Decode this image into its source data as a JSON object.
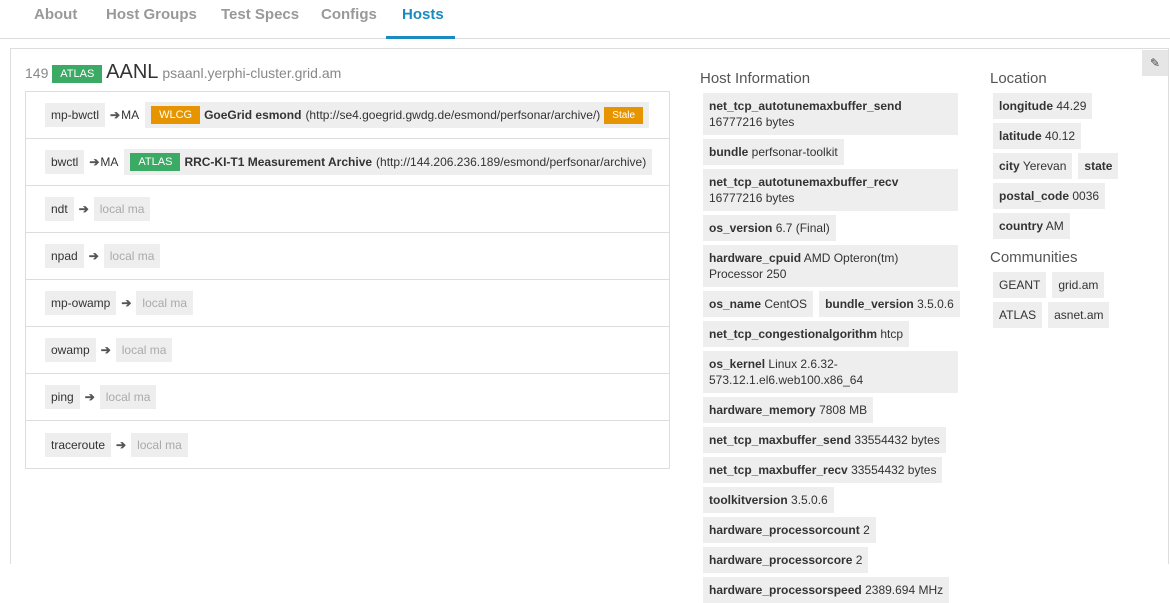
{
  "nav": {
    "tabs": [
      {
        "label": "About"
      },
      {
        "label": "Host Groups"
      },
      {
        "label": "Test Specs"
      },
      {
        "label": "Configs"
      },
      {
        "label": "Hosts",
        "active": true
      }
    ]
  },
  "host": {
    "id": "149",
    "community": "ATLAS",
    "sitename": "AANL",
    "hostname": "psaanl.yerphi-cluster.grid.am"
  },
  "tests": [
    {
      "service": "mp-bwctl",
      "ma_label": "MA",
      "ma_badge": "WLCG",
      "ma_name": "GoeGrid esmond",
      "ma_url": "(http://se4.goegrid.gwdg.de/esmond/perfsonar/archive/)",
      "status": "Stale"
    },
    {
      "service": "bwctl",
      "ma_label": "MA",
      "ma_badge": "ATLAS",
      "ma_name": "RRC-KI-T1 Measurement Archive",
      "ma_url": "(http://144.206.236.189/esmond/perfsonar/archive)"
    },
    {
      "service": "ndt",
      "local": "local ma"
    },
    {
      "service": "npad",
      "local": "local ma"
    },
    {
      "service": "mp-owamp",
      "local": "local ma"
    },
    {
      "service": "owamp",
      "local": "local ma"
    },
    {
      "service": "ping",
      "local": "local ma"
    },
    {
      "service": "traceroute",
      "local": "local ma"
    }
  ],
  "host_info": {
    "title": "Host Information",
    "items": [
      {
        "k": "net_tcp_autotunemaxbuffer_send",
        "v": "16777216 bytes"
      },
      {
        "k": "bundle",
        "v": "perfsonar-toolkit"
      },
      {
        "k": "net_tcp_autotunemaxbuffer_recv",
        "v": "16777216 bytes"
      },
      {
        "k": "os_version",
        "v": "6.7 (Final)"
      },
      {
        "k": "hardware_cpuid",
        "v": "AMD Opteron(tm) Processor 250"
      },
      {
        "k": "os_name",
        "v": "CentOS"
      },
      {
        "k": "bundle_version",
        "v": "3.5.0.6"
      },
      {
        "k": "net_tcp_congestionalgorithm",
        "v": "htcp"
      },
      {
        "k": "os_kernel",
        "v": "Linux 2.6.32-573.12.1.el6.web100.x86_64"
      },
      {
        "k": "hardware_memory",
        "v": "7808 MB"
      },
      {
        "k": "net_tcp_maxbuffer_send",
        "v": "33554432 bytes"
      },
      {
        "k": "net_tcp_maxbuffer_recv",
        "v": "33554432 bytes"
      },
      {
        "k": "toolkitversion",
        "v": "3.5.0.6"
      },
      {
        "k": "hardware_processorcount",
        "v": "2"
      },
      {
        "k": "hardware_processorcore",
        "v": "2"
      },
      {
        "k": "hardware_processorspeed",
        "v": "2389.694 MHz"
      }
    ]
  },
  "location": {
    "title": "Location",
    "items": [
      {
        "k": "longitude",
        "v": "44.29"
      },
      {
        "k": "latitude",
        "v": "40.12"
      },
      {
        "k": "city",
        "v": "Yerevan"
      },
      {
        "k": "state",
        "v": ""
      },
      {
        "k": "postal_code",
        "v": "0036"
      },
      {
        "k": "country",
        "v": "AM"
      }
    ]
  },
  "communities": {
    "title": "Communities",
    "items": [
      "GEANT",
      "grid.am",
      "ATLAS",
      "asnet.am"
    ]
  },
  "icons": {
    "edit": "edit-icon",
    "arrow": "arrow-right-icon"
  },
  "colors": {
    "accent": "#1a8bc0",
    "atlas": "#3aaa65",
    "wlcg": "#e69500"
  }
}
